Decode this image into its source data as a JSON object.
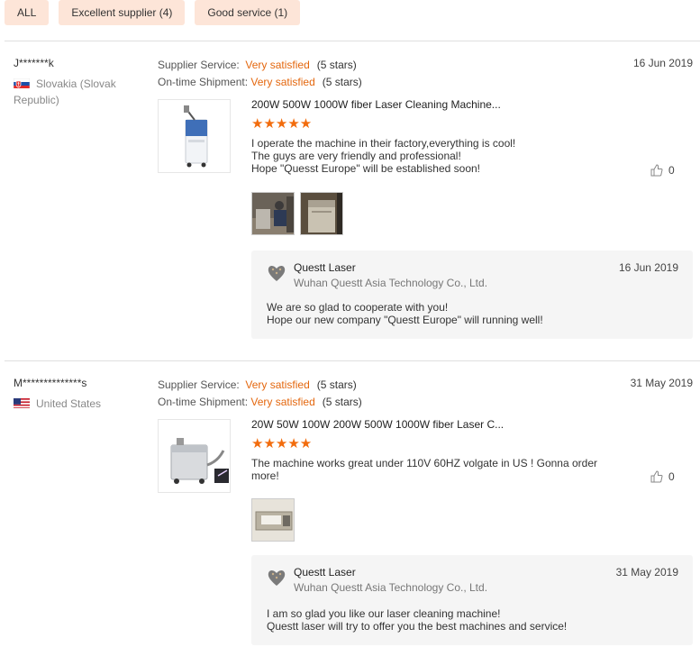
{
  "filters": [
    {
      "label": "ALL"
    },
    {
      "label": "Excellent supplier (4)"
    },
    {
      "label": "Good service (1)"
    }
  ],
  "labels": {
    "supplier_service": "Supplier Service:",
    "ontime_shipment": "On-time Shipment:"
  },
  "colors": {
    "accent": "#e4670e",
    "chip_bg": "#fde5d8",
    "reply_bg": "#f5f5f5"
  },
  "reviews": [
    {
      "buyer": "J*******k",
      "country": "Slovakia (Slovak Republic)",
      "flag": "slovakia-flag-icon",
      "supplier_rating": "Very satisfied",
      "supplier_stars": "(5 stars)",
      "shipment_rating": "Very satisfied",
      "shipment_stars": "(5 stars)",
      "date": "16 Jun 2019",
      "product_title": "200W 500W 1000W fiber Laser Cleaning Machine...",
      "stars": "★★★★★",
      "text": [
        "I operate the machine in their factory,everything is cool!",
        "The guys are very friendly and professional!",
        "Hope \"Quesst Europe\" will be established soon!"
      ],
      "likes": "0",
      "reply": {
        "name": "Questt Laser",
        "company": "Wuhan Questt Asia Technology Co., Ltd.",
        "date": "16 Jun 2019",
        "text": [
          "We are so glad to cooperate with you!",
          "Hope our new company \"Questt Europe\" will running well!"
        ]
      }
    },
    {
      "buyer": "M**************s",
      "country": "United States",
      "flag": "united-states-flag-icon",
      "supplier_rating": "Very satisfied",
      "supplier_stars": "(5 stars)",
      "shipment_rating": "Very satisfied",
      "shipment_stars": "(5 stars)",
      "date": "31 May 2019",
      "product_title": "20W 50W 100W 200W 500W 1000W fiber Laser C...",
      "stars": "★★★★★",
      "text": [
        "The machine works great under 110V 60HZ volgate in US ! Gonna order more!"
      ],
      "likes": "0",
      "reply": {
        "name": "Questt Laser",
        "company": "Wuhan Questt Asia Technology Co., Ltd.",
        "date": "31 May 2019",
        "text": [
          "I am so glad you like our laser cleaning machine!",
          "Questt laser will try to offer you the best machines and service!"
        ]
      }
    }
  ]
}
